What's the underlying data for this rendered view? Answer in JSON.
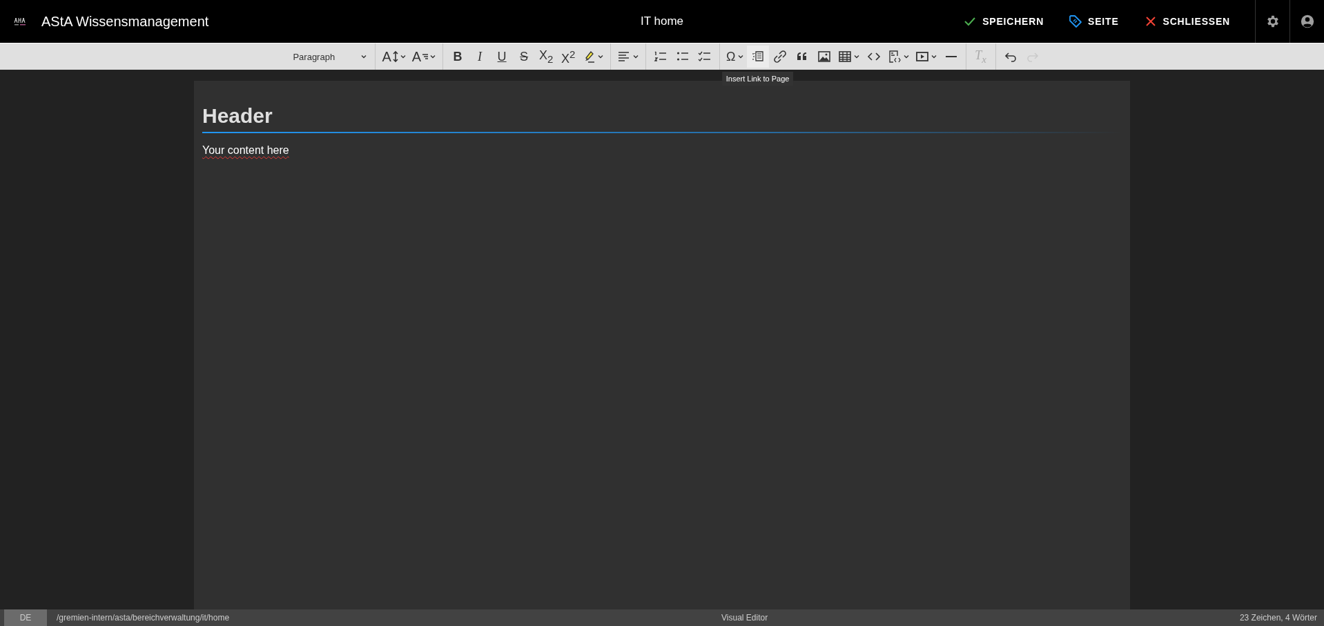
{
  "header": {
    "app_title": "AStA Wissensmanagement",
    "page_title": "IT home",
    "actions": [
      {
        "kind": "save",
        "label": "SPEICHERN"
      },
      {
        "kind": "page",
        "label": "SEITE"
      },
      {
        "kind": "close",
        "label": "SCHLIESSEN"
      }
    ]
  },
  "toolbar": {
    "groups": [
      [
        {
          "kind": "select",
          "label": "Paragraph",
          "dropdown": true,
          "disabled": false,
          "hovered": false
        }
      ],
      [
        {
          "kind": "font-size",
          "label": "A",
          "dropdown": true,
          "disabled": false,
          "hovered": false
        },
        {
          "kind": "font-family",
          "label": "A",
          "dropdown": true,
          "disabled": false,
          "hovered": false
        }
      ],
      [
        {
          "kind": "bold",
          "label": "B",
          "dropdown": false,
          "disabled": false,
          "hovered": false
        },
        {
          "kind": "italic",
          "label": "I",
          "dropdown": false,
          "disabled": false,
          "hovered": false
        },
        {
          "kind": "underline",
          "label": "U",
          "dropdown": false,
          "disabled": false,
          "hovered": false
        },
        {
          "kind": "strike",
          "label": "S",
          "dropdown": false,
          "disabled": false,
          "hovered": false
        },
        {
          "kind": "glyph",
          "label": "X$_{2}$",
          "dropdown": false,
          "disabled": false,
          "hovered": false
        },
        {
          "kind": "glyph",
          "label": "X$^{2}$",
          "dropdown": false,
          "disabled": false,
          "hovered": false
        },
        {
          "kind": "highlight",
          "dropdown": true,
          "disabled": false,
          "hovered": false
        }
      ],
      [
        {
          "kind": "align",
          "dropdown": true,
          "disabled": false,
          "hovered": false
        }
      ],
      [
        {
          "kind": "numbered-list",
          "dropdown": false,
          "disabled": false,
          "hovered": false
        },
        {
          "kind": "bullet-list",
          "dropdown": false,
          "disabled": false,
          "hovered": false
        },
        {
          "kind": "todo-list",
          "dropdown": false,
          "disabled": false,
          "hovered": false
        }
      ],
      [
        {
          "kind": "glyph",
          "label": "Ω",
          "dropdown": true,
          "disabled": false,
          "hovered": false
        },
        {
          "kind": "link-page",
          "dropdown": false,
          "disabled": false,
          "hovered": true
        },
        {
          "kind": "link",
          "dropdown": false,
          "disabled": false,
          "hovered": false
        },
        {
          "kind": "quote",
          "dropdown": false,
          "disabled": false,
          "hovered": false
        },
        {
          "kind": "image",
          "dropdown": false,
          "disabled": false,
          "hovered": false
        },
        {
          "kind": "table",
          "dropdown": true,
          "disabled": false,
          "hovered": false
        },
        {
          "kind": "code",
          "dropdown": false,
          "disabled": false,
          "hovered": false
        },
        {
          "kind": "code-block",
          "dropdown": true,
          "disabled": false,
          "hovered": false
        },
        {
          "kind": "media",
          "dropdown": true,
          "disabled": false,
          "hovered": false
        },
        {
          "kind": "hr",
          "dropdown": false,
          "disabled": false,
          "hovered": false
        }
      ],
      [
        {
          "kind": "italic",
          "label": "T$_{x}$",
          "dropdown": false,
          "disabled": true,
          "hovered": false
        }
      ],
      [
        {
          "kind": "undo",
          "dropdown": false,
          "disabled": false,
          "hovered": false
        },
        {
          "kind": "redo",
          "dropdown": false,
          "disabled": true,
          "hovered": false
        }
      ]
    ],
    "tooltip": "Insert Link to Page"
  },
  "document": {
    "heading": "Header",
    "paragraph": "Your content here"
  },
  "status_bar": {
    "locale": "DE",
    "path": "/gremien-intern/asta/bereichverwaltung/it/home",
    "mode": "Visual Editor",
    "counts": "23 Zeichen, 4 Wörter"
  }
}
